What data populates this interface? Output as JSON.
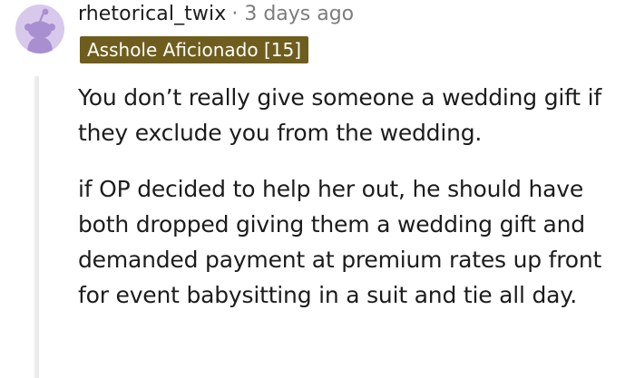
{
  "comment": {
    "username": "rhetorical_twix",
    "separator": "·",
    "timestamp": "3 days ago",
    "flair": "Asshole Aficionado [15]",
    "paragraphs": [
      "You don’t really give someone a wedding gift if they exclude you from the wedding.",
      "if OP decided to help her out, he should have both dropped giving them a wedding gift and demanded payment at premium rates up front for event babysitting in a suit and tie all day."
    ]
  },
  "colors": {
    "flair_background": "#6e5d1d",
    "avatar_background": "#d8c8ec",
    "avatar_figure": "#a88fd0",
    "meta_text": "#7c7c7c",
    "thread_line": "#ececec"
  },
  "icons": {
    "avatar": "snoo-avatar-icon"
  }
}
